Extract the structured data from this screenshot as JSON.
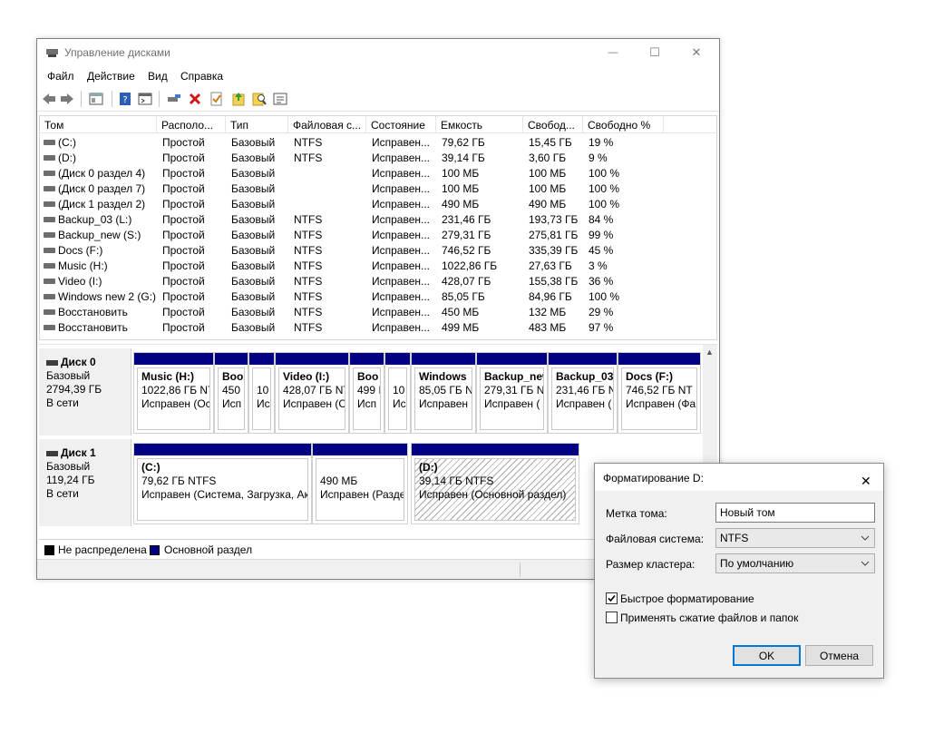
{
  "window": {
    "title": "Управление дисками",
    "controls": {
      "minimize": "—",
      "maximize": "☐",
      "close": "✕"
    }
  },
  "menu": [
    "Файл",
    "Действие",
    "Вид",
    "Справка"
  ],
  "toolbar": [
    "back-icon",
    "forward-icon",
    "view-icon",
    "help-icon",
    "console-icon",
    "properties-icon",
    "delete-icon",
    "check-icon",
    "up-icon",
    "search-icon",
    "list-icon"
  ],
  "columns": [
    "Том",
    "Располо...",
    "Тип",
    "Файловая с...",
    "Состояние",
    "Емкость",
    "Свобод...",
    "Свободно %"
  ],
  "volumes": [
    [
      "(C:)",
      "Простой",
      "Базовый",
      "NTFS",
      "Исправен...",
      "79,62 ГБ",
      "15,45 ГБ",
      "19 %"
    ],
    [
      "(D:)",
      "Простой",
      "Базовый",
      "NTFS",
      "Исправен...",
      "39,14 ГБ",
      "3,60 ГБ",
      "9 %"
    ],
    [
      "(Диск 0 раздел 4)",
      "Простой",
      "Базовый",
      "",
      "Исправен...",
      "100 МБ",
      "100 МБ",
      "100 %"
    ],
    [
      "(Диск 0 раздел 7)",
      "Простой",
      "Базовый",
      "",
      "Исправен...",
      "100 МБ",
      "100 МБ",
      "100 %"
    ],
    [
      "(Диск 1 раздел 2)",
      "Простой",
      "Базовый",
      "",
      "Исправен...",
      "490 МБ",
      "490 МБ",
      "100 %"
    ],
    [
      "Backup_03 (L:)",
      "Простой",
      "Базовый",
      "NTFS",
      "Исправен...",
      "231,46 ГБ",
      "193,73 ГБ",
      "84 %"
    ],
    [
      "Backup_new (S:)",
      "Простой",
      "Базовый",
      "NTFS",
      "Исправен...",
      "279,31 ГБ",
      "275,81 ГБ",
      "99 %"
    ],
    [
      "Docs (F:)",
      "Простой",
      "Базовый",
      "NTFS",
      "Исправен...",
      "746,52 ГБ",
      "335,39 ГБ",
      "45 %"
    ],
    [
      "Music (H:)",
      "Простой",
      "Базовый",
      "NTFS",
      "Исправен...",
      "1022,86 ГБ",
      "27,63 ГБ",
      "3 %"
    ],
    [
      "Video (I:)",
      "Простой",
      "Базовый",
      "NTFS",
      "Исправен...",
      "428,07 ГБ",
      "155,38 ГБ",
      "36 %"
    ],
    [
      "Windows new 2 (G:)",
      "Простой",
      "Базовый",
      "NTFS",
      "Исправен...",
      "85,05 ГБ",
      "84,96 ГБ",
      "100 %"
    ],
    [
      "Восстановить",
      "Простой",
      "Базовый",
      "NTFS",
      "Исправен...",
      "450 МБ",
      "132 МБ",
      "29 %"
    ],
    [
      "Восстановить",
      "Простой",
      "Базовый",
      "NTFS",
      "Исправен...",
      "499 МБ",
      "483 МБ",
      "97 %"
    ]
  ],
  "disks": [
    {
      "name": "Диск 0",
      "type": "Базовый",
      "size": "2794,39 ГБ",
      "status": "В сети",
      "partitions": [
        {
          "title": "Music  (H:)",
          "l2": "1022,86 ГБ NT",
          "l3": "Исправен (Ос"
        },
        {
          "title": "Boo",
          "l2": "450",
          "l3": "Исп"
        },
        {
          "title": "",
          "l2": "10",
          "l3": "Ис"
        },
        {
          "title": "Video  (I:)",
          "l2": "428,07 ГБ NT",
          "l3": "Исправен (С"
        },
        {
          "title": "Boo",
          "l2": "499 I",
          "l3": "Исп"
        },
        {
          "title": "",
          "l2": "10",
          "l3": "Ис"
        },
        {
          "title": "Windows",
          "l2": "85,05 ГБ N",
          "l3": "Исправен"
        },
        {
          "title": "Backup_new",
          "l2": "279,31 ГБ N",
          "l3": "Исправен ("
        },
        {
          "title": "Backup_03",
          "l2": "231,46 ГБ N",
          "l3": "Исправен ("
        },
        {
          "title": "Docs  (F:)",
          "l2": "746,52 ГБ NT",
          "l3": "Исправен (Фа"
        }
      ]
    },
    {
      "name": "Диск 1",
      "type": "Базовый",
      "size": "119,24 ГБ",
      "status": "В сети",
      "partitions": [
        {
          "title": "(C:)",
          "l2": "79,62 ГБ NTFS",
          "l3": "Исправен (Система, Загрузка, Ак"
        },
        {
          "title": "",
          "l2": "490 МБ",
          "l3": "Исправен (Разде"
        },
        {
          "title": "(D:)",
          "l2": "39,14 ГБ NTFS",
          "l3": "Исправен (Основной раздел)"
        }
      ]
    }
  ],
  "legend": {
    "unallocated": "Не распределена",
    "primary": "Основной раздел",
    "unallocated_color": "#000000",
    "primary_color": "#000080"
  },
  "dialog": {
    "title": "Форматирование D:",
    "label_volume": "Метка тома:",
    "volume_value": "Новый том",
    "label_fs": "Файловая система:",
    "fs_value": "NTFS",
    "label_cluster": "Размер кластера:",
    "cluster_value": "По умолчанию",
    "quick_format": "Быстрое форматирование",
    "quick_format_checked": true,
    "compression": "Применять сжатие файлов и папок",
    "compression_checked": false,
    "ok": "OK",
    "cancel": "Отмена",
    "close": "✕"
  }
}
